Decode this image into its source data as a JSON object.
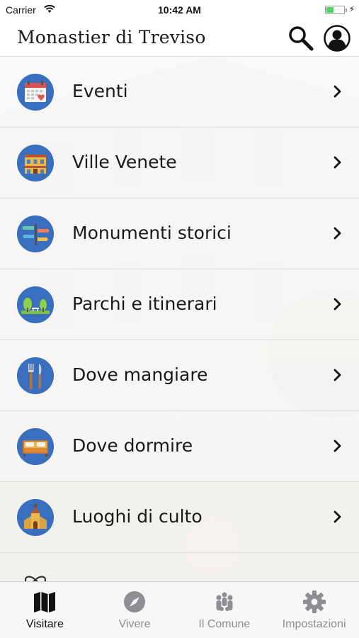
{
  "status_bar": {
    "carrier": "Carrier",
    "time": "10:42 AM"
  },
  "header": {
    "title": "Monastier di Treviso"
  },
  "menu": {
    "items": [
      {
        "label": "Eventi",
        "icon": "calendar-icon"
      },
      {
        "label": "Ville Venete",
        "icon": "villa-icon"
      },
      {
        "label": "Monumenti storici",
        "icon": "signpost-icon"
      },
      {
        "label": "Parchi e itinerari",
        "icon": "park-icon"
      },
      {
        "label": "Dove mangiare",
        "icon": "fork-knife-icon"
      },
      {
        "label": "Dove dormire",
        "icon": "bed-icon"
      },
      {
        "label": "Luoghi di culto",
        "icon": "church-icon"
      }
    ]
  },
  "tabs": [
    {
      "label": "Visitare",
      "icon": "map-icon",
      "active": true
    },
    {
      "label": "Vivere",
      "icon": "compass-icon",
      "active": false
    },
    {
      "label": "Il Comune",
      "icon": "people-icon",
      "active": false
    },
    {
      "label": "Impostazioni",
      "icon": "gear-icon",
      "active": false
    }
  ],
  "colors": {
    "icon_circle": "#3a6fbf",
    "tab_inactive": "#8e8e93",
    "battery": "#4cd964"
  }
}
